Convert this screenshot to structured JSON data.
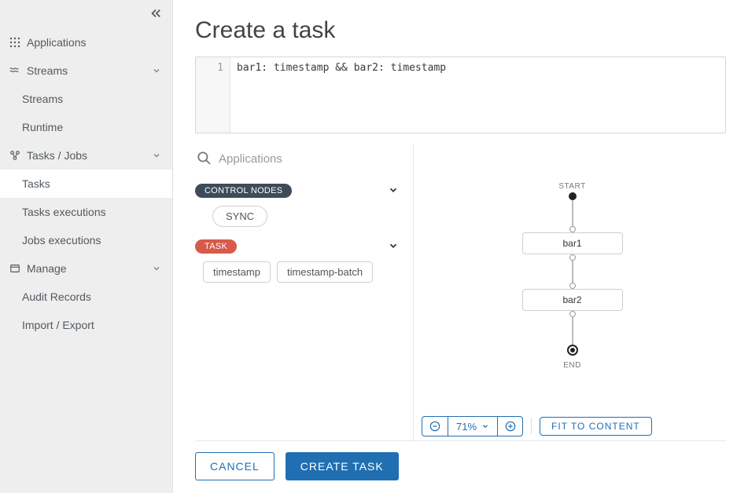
{
  "sidebar": {
    "applications_label": "Applications",
    "streams_label": "Streams",
    "streams_sub1": "Streams",
    "streams_sub2": "Runtime",
    "tasks_label": "Tasks / Jobs",
    "tasks_sub1": "Tasks",
    "tasks_sub2": "Tasks executions",
    "tasks_sub3": "Jobs executions",
    "manage_label": "Manage",
    "manage_sub1": "Audit Records",
    "manage_sub2": "Import / Export"
  },
  "page": {
    "title": "Create a task"
  },
  "editor": {
    "line_number": "1",
    "code": "bar1: timestamp && bar2: timestamp"
  },
  "palette": {
    "search_placeholder": "Applications",
    "section_control_label": "CONTROL NODES",
    "control_items": [
      "SYNC"
    ],
    "section_task_label": "TASK",
    "task_items": [
      "timestamp",
      "timestamp-batch"
    ]
  },
  "graph": {
    "start_label": "START",
    "end_label": "END",
    "nodes": [
      "bar1",
      "bar2"
    ]
  },
  "zoom": {
    "percent": "71%",
    "fit_label": "FIT TO CONTENT"
  },
  "footer": {
    "cancel": "CANCEL",
    "create": "CREATE TASK"
  }
}
